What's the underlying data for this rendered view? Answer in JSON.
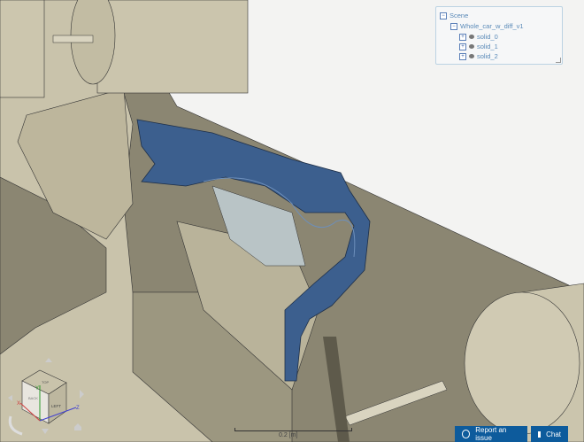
{
  "scene_tree": {
    "root": "Scene",
    "model": "Whole_car_w_diff_v1",
    "items": [
      {
        "label": "solid_0"
      },
      {
        "label": "solid_1"
      },
      {
        "label": "solid_2"
      }
    ]
  },
  "view_cube": {
    "faces": [
      "TOP",
      "BACK",
      "LEFT"
    ],
    "axes": [
      "X",
      "Y",
      "Z"
    ]
  },
  "scale_bar": {
    "label": "0.2 [m]"
  },
  "buttons": {
    "report": "Report an issue",
    "chat": "Chat"
  },
  "colors": {
    "geometry": "#c8c2aa",
    "shadow": "#8a8570",
    "surface": "#3c5f8e",
    "button": "#0d5b9c",
    "tree_text": "#5a8ab8"
  }
}
